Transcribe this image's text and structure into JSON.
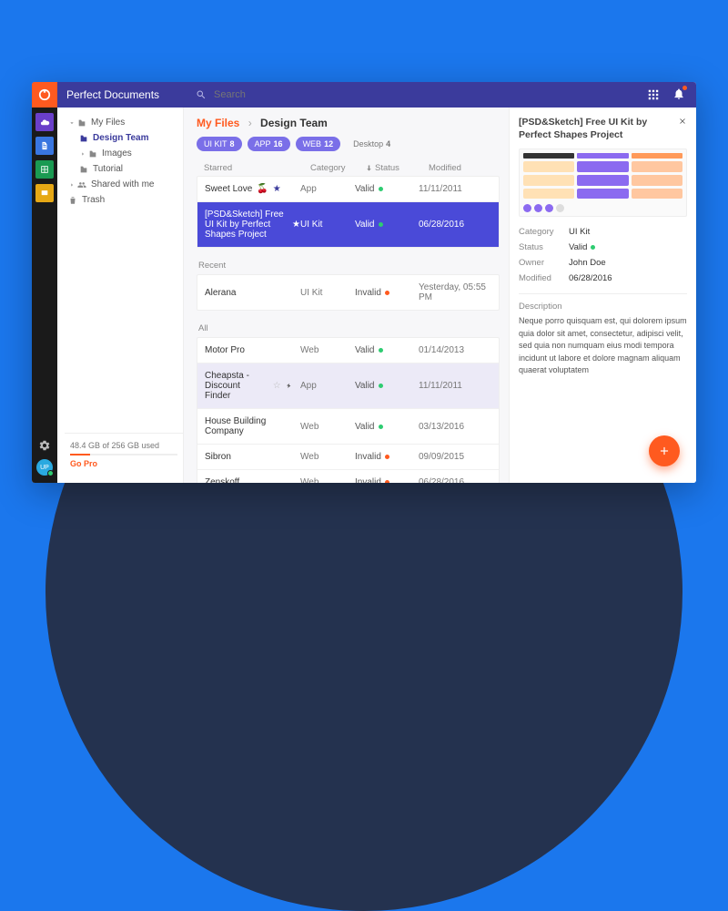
{
  "app": {
    "title": "Perfect Documents",
    "search_placeholder": "Search"
  },
  "rail_avatar": "UP",
  "tree": {
    "items": [
      "My Files",
      "Design Team",
      "Images",
      "Tutorial",
      "Shared with me",
      "Trash"
    ]
  },
  "storage": {
    "label": "48.4 GB of 256 GB used",
    "go": "Go Pro"
  },
  "crumb": {
    "root": "My Files",
    "current": "Design Team"
  },
  "chips": [
    {
      "label": "UI KIT",
      "count": "8"
    },
    {
      "label": "APP",
      "count": "16"
    },
    {
      "label": "WEB",
      "count": "12"
    },
    {
      "label": "Desktop",
      "count": "4",
      "plain": true
    }
  ],
  "cols": {
    "name": "Starred",
    "cat": "Category",
    "stat": "Status",
    "mod": "Modified"
  },
  "sections": {
    "starred": "Starred",
    "recent": "Recent",
    "all": "All"
  },
  "starred_rows": [
    {
      "name": "Sweet Love",
      "cat": "App",
      "stat": "Valid",
      "ok": true,
      "mod": "11/11/2011",
      "emoji": true
    },
    {
      "name": "[PSD&Sketch] Free UI Kit by Perfect Shapes Project",
      "cat": "UI Kit",
      "stat": "Valid",
      "ok": true,
      "mod": "06/28/2016",
      "sel": true
    }
  ],
  "recent_rows": [
    {
      "name": "Alerana",
      "cat": "UI Kit",
      "stat": "Invalid",
      "ok": false,
      "mod": "Yesterday, 05:55 PM"
    }
  ],
  "all_rows": [
    {
      "name": "Motor Pro",
      "cat": "Web",
      "stat": "Valid",
      "ok": true,
      "mod": "01/14/2013"
    },
    {
      "name": "Cheapsta - Discount Finder",
      "cat": "App",
      "stat": "Valid",
      "ok": true,
      "mod": "11/11/2011",
      "hover": true
    },
    {
      "name": "House Building Company",
      "cat": "Web",
      "stat": "Valid",
      "ok": true,
      "mod": "03/13/2016"
    },
    {
      "name": "Sibron",
      "cat": "Web",
      "stat": "Invalid",
      "ok": false,
      "mod": "09/09/2015"
    },
    {
      "name": "Zenskoff",
      "cat": "Web",
      "stat": "Invalid",
      "ok": false,
      "mod": "06/28/2016"
    }
  ],
  "details": {
    "title": "[PSD&Sketch] Free UI Kit by Perfect Shapes Project",
    "cat_k": "Category",
    "cat_v": "UI Kit",
    "stat_k": "Status",
    "stat_v": "Valid",
    "own_k": "Owner",
    "own_v": "John Doe",
    "mod_k": "Modified",
    "mod_v": "06/28/2016",
    "desc_h": "Description",
    "desc": "Neque porro quisquam est, qui dolorem ipsum quia dolor sit amet, consectetur, adipisci velit, sed quia non numquam eius modi tempora incidunt ut labore et dolore magnam aliquam quaerat voluptatem"
  }
}
